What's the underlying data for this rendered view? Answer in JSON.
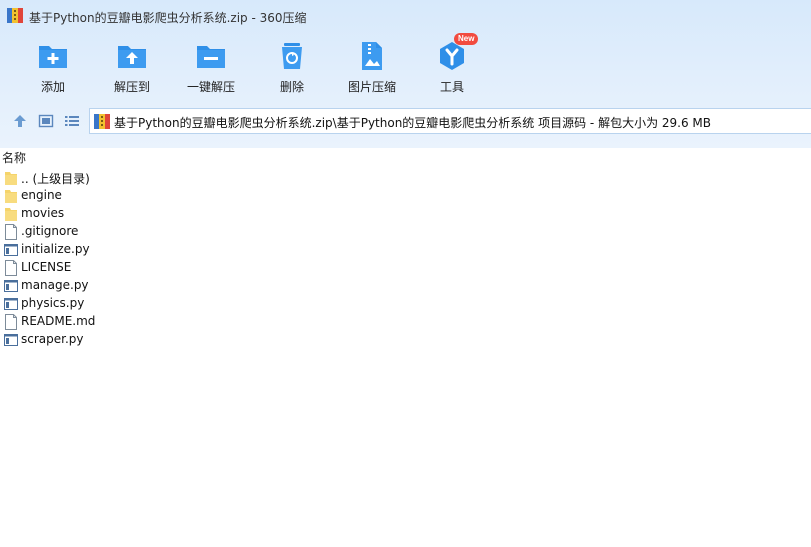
{
  "window": {
    "title": "基于Python的豆瓣电影爬虫分析系统.zip - 360压缩"
  },
  "toolbar": {
    "items": [
      {
        "label": "添加",
        "icon": "add-icon"
      },
      {
        "label": "解压到",
        "icon": "extract-to-icon"
      },
      {
        "label": "一键解压",
        "icon": "one-click-extract-icon"
      },
      {
        "label": "删除",
        "icon": "delete-icon"
      },
      {
        "label": "图片压缩",
        "icon": "image-compress-icon"
      },
      {
        "label": "工具",
        "icon": "tools-icon",
        "badge": "New"
      }
    ]
  },
  "address": {
    "path": "基于Python的豆瓣电影爬虫分析系统.zip\\基于Python的豆瓣电影爬虫分析系统 项目源码 - 解包大小为 29.6 MB"
  },
  "columns": {
    "name": "名称"
  },
  "files": [
    {
      "name": ".. (上级目录)",
      "type": "folder"
    },
    {
      "name": "engine",
      "type": "folder"
    },
    {
      "name": "movies",
      "type": "folder"
    },
    {
      "name": ".gitignore",
      "type": "file"
    },
    {
      "name": "initialize.py",
      "type": "py"
    },
    {
      "name": "LICENSE",
      "type": "file"
    },
    {
      "name": "manage.py",
      "type": "py"
    },
    {
      "name": "physics.py",
      "type": "py"
    },
    {
      "name": "README.md",
      "type": "file"
    },
    {
      "name": "scraper.py",
      "type": "py"
    }
  ],
  "colors": {
    "accent": "#2f8fe8",
    "badge": "#f24b3f",
    "header_bg": "#dcebfb"
  }
}
